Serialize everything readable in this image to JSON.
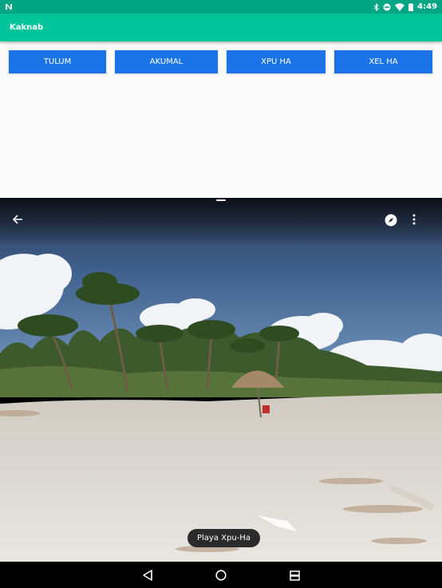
{
  "status_bar": {
    "time": "4:49",
    "notification_icon": "n-icon",
    "icons": [
      "bluetooth-icon",
      "do-not-disturb-icon",
      "wifi-icon",
      "battery-icon"
    ]
  },
  "app": {
    "title": "Kaknab",
    "header_color": "#00c59c"
  },
  "buttons": [
    {
      "label": "TULUM"
    },
    {
      "label": "AKUMAL"
    },
    {
      "label": "XPU HA"
    },
    {
      "label": "XEL HA"
    }
  ],
  "button_color": "#1b73e8",
  "street_view": {
    "place_label": "Playa Xpu-Ha",
    "controls": [
      "back-arrow-icon",
      "compass-icon",
      "more-vert-icon"
    ]
  },
  "nav_bar": {
    "icons": [
      "back-triangle-icon",
      "home-circle-icon",
      "recents-square-icon"
    ]
  }
}
